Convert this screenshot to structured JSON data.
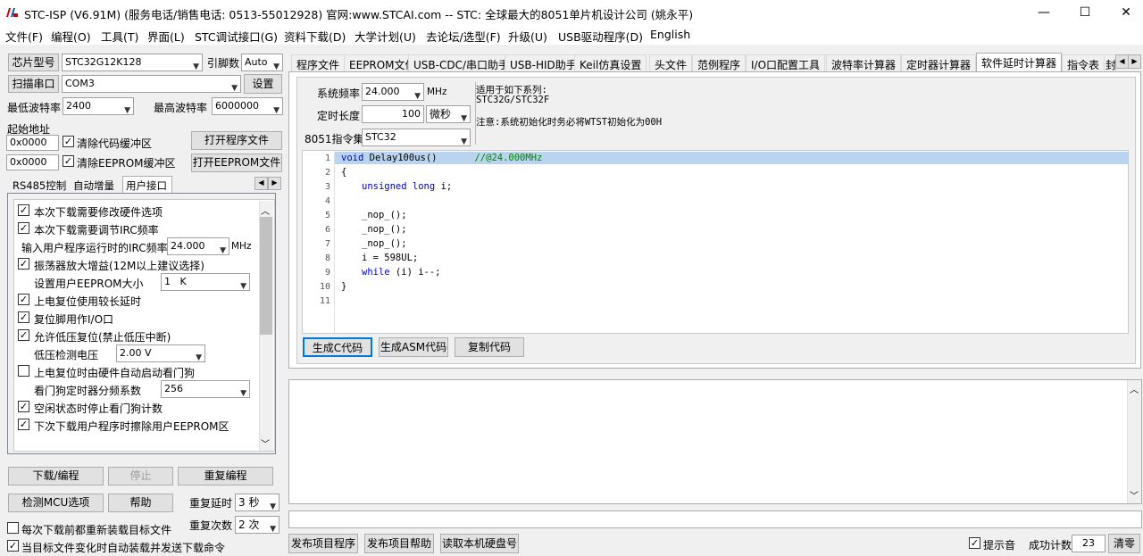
{
  "window": {
    "title": "STC-ISP (V6.91M) (服务电话/销售电话: 0513-55012928) 官网:www.STCAI.com  -- STC: 全球最大的8051单片机设计公司 (姚永平)",
    "min": "—",
    "max": "☐",
    "close": "✕"
  },
  "menu": [
    "文件(F)",
    "编程(O)",
    "工具(T)",
    "界面(L)",
    "STC调试接口(G)",
    "资料下载(D)",
    "大学计划(U)",
    "去论坛/选型(F)",
    "升级(U)",
    "USB驱动程序(D)",
    "English"
  ],
  "left": {
    "chip_label": "芯片型号",
    "chip_value": "STC32G12K128",
    "pin_label": "引脚数",
    "pin_value": "Auto",
    "scan_label": "扫描串口",
    "port_value": "COM3",
    "settings_label": "设置",
    "min_baud_label": "最低波特率",
    "min_baud_value": "2400",
    "max_baud_label": "最高波特率",
    "max_baud_value": "6000000",
    "start_addr_label": "起始地址",
    "addr1": "0x0000",
    "clear_code": "清除代码缓冲区",
    "open_prog": "打开程序文件",
    "addr2": "0x0000",
    "clear_eeprom": "清除EEPROM缓冲区",
    "open_eeprom": "打开EEPROM文件",
    "subtabs": [
      "RS485控制",
      "自动增量",
      "用户接口"
    ],
    "options": {
      "o1": "本次下载需要修改硬件选项",
      "o2": "本次下载需要调节IRC频率",
      "irc_label": "输入用户程序运行时的IRC频率",
      "irc_value": "24.000",
      "irc_unit": "MHz",
      "o3": "振荡器放大增益(12M以上建议选择)",
      "eeprom_label": "设置用户EEPROM大小",
      "eeprom_value": "1   K",
      "o4": "上电复位使用较长延时",
      "o5": "复位脚用作I/O口",
      "o6": "允许低压复位(禁止低压中断)",
      "lvd_label": "低压检测电压",
      "lvd_value": "2.00 V",
      "o7": "上电复位时由硬件自动启动看门狗",
      "wdt_label": "看门狗定时器分频系数",
      "wdt_value": "256",
      "o8": "空闲状态时停止看门狗计数",
      "o9": "下次下载用户程序时擦除用户EEPROM区"
    },
    "download": "下载/编程",
    "stop": "停止",
    "reprog": "重复编程",
    "check_mcu": "检测MCU选项",
    "help": "帮助",
    "repeat_delay_label": "重复延时",
    "repeat_delay_value": "3 秒",
    "repeat_count_label": "重复次数",
    "repeat_count_value": "2 次",
    "reload": "每次下载前都重新装载目标文件",
    "auto_send": "当目标文件变化时自动装载并发送下载命令"
  },
  "tabs": [
    "程序文件",
    "EEPROM文件",
    "USB-CDC/串口助手",
    "USB-HID助手",
    "Keil仿真设置",
    "头文件",
    "范例程序",
    "I/O口配置工具",
    "波特率计算器",
    "定时器计算器",
    "软件延时计算器",
    "指令表",
    "封"
  ],
  "delay": {
    "sysfreq_label": "系统频率",
    "sysfreq_value": "24.000",
    "sysfreq_unit": "MHz",
    "time_label": "定时长度",
    "time_value": "100",
    "time_unit": "微秒",
    "isa_label": "8051指令集",
    "isa_value": "STC32",
    "info1": "适用于如下系列:",
    "info2": "STC32G/STC32F",
    "info3": "注意:系统初始化时务必将WTST初始化为00H",
    "gen_c": "生成C代码",
    "gen_asm": "生成ASM代码",
    "copy": "复制代码"
  },
  "code": {
    "lines": [
      "1",
      "2",
      "3",
      "4",
      "5",
      "6",
      "7",
      "8",
      "9",
      "10",
      "11"
    ],
    "l1a": "void",
    "l1b": " Delay100us()",
    "l1c": "//@24.000MHz",
    "l2": "{",
    "l3a": "unsigned",
    "l3b": "long",
    "l3c": " i;",
    "l5": "_nop_();",
    "l6": "_nop_();",
    "l7": "_nop_();",
    "l8": "i = 598UL;",
    "l9a": "while",
    "l9b": " (i) i--;",
    "l10": "}"
  },
  "bottom": {
    "publish": "发布项目程序",
    "publish_help": "发布项目帮助",
    "read_disk": "读取本机硬盘号",
    "sound": "提示音",
    "success_label": "成功计数",
    "success_value": "23",
    "clear": "清零"
  }
}
